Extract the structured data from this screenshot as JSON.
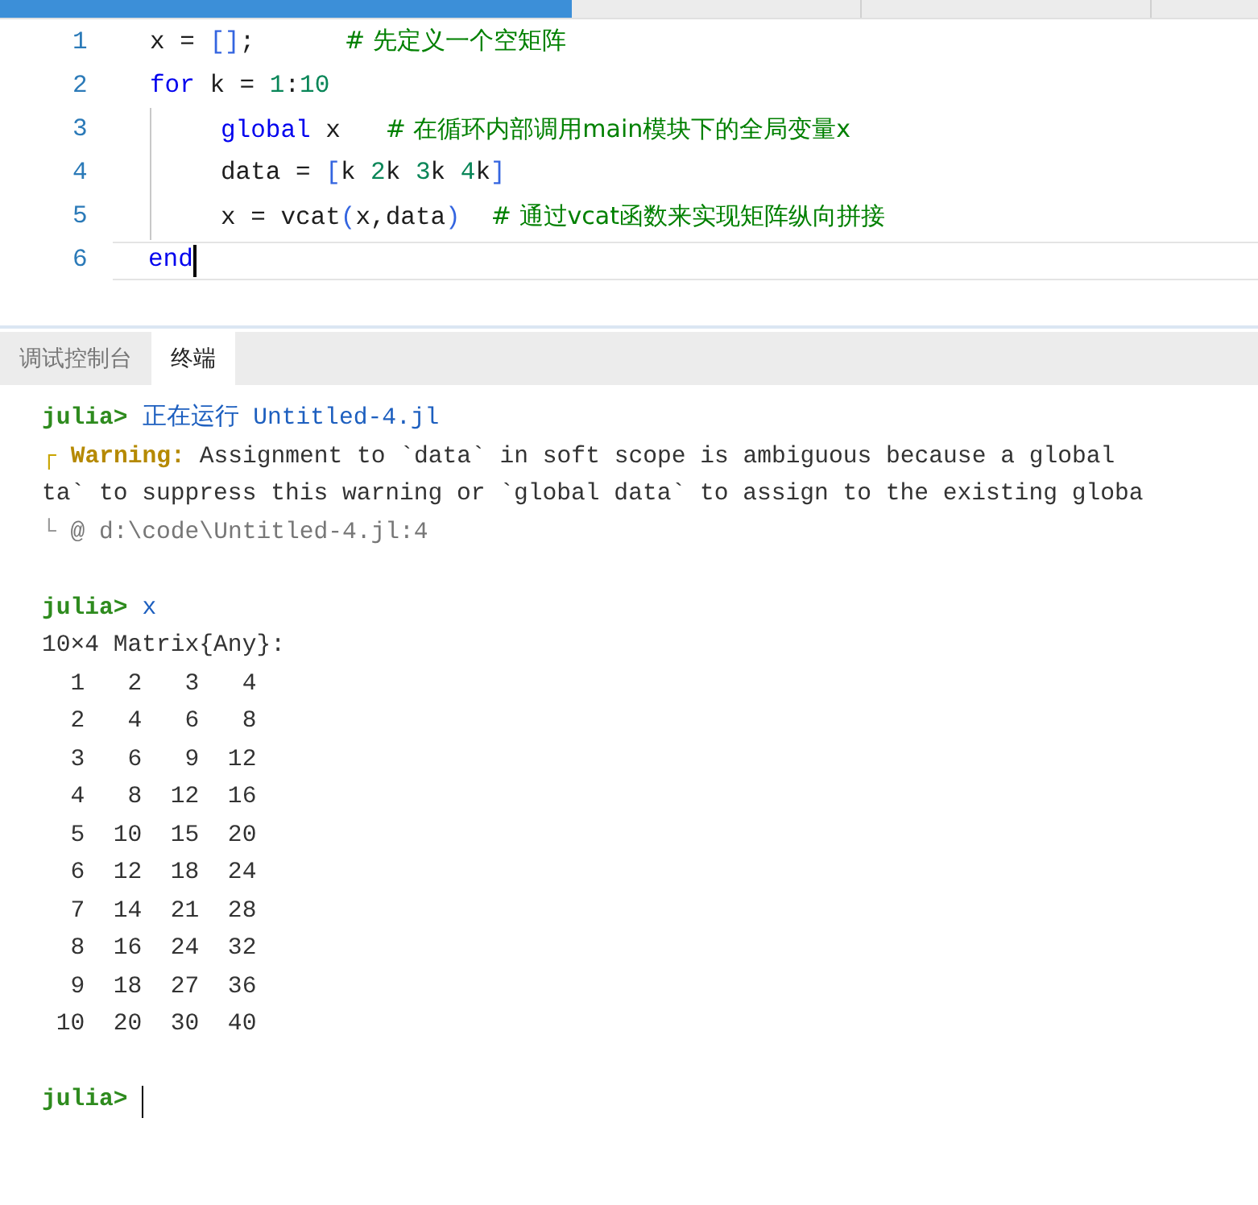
{
  "editor": {
    "tabs": [
      {
        "selected": true
      },
      {
        "selected": false
      },
      {
        "selected": false
      }
    ],
    "lines": [
      {
        "number": "1",
        "current": false,
        "indent": false,
        "tokens": [
          {
            "kind": "plain",
            "text": "x = "
          },
          {
            "kind": "bracket",
            "text": "[]"
          },
          {
            "kind": "plain",
            "text": ";      "
          },
          {
            "kind": "comment",
            "text": "# 先定义一个空矩阵"
          }
        ]
      },
      {
        "number": "2",
        "current": false,
        "indent": false,
        "tokens": [
          {
            "kind": "keyword",
            "text": "for"
          },
          {
            "kind": "plain",
            "text": " k = "
          },
          {
            "kind": "number",
            "text": "1"
          },
          {
            "kind": "plain",
            "text": ":"
          },
          {
            "kind": "number",
            "text": "10"
          }
        ]
      },
      {
        "number": "3",
        "current": false,
        "indent": true,
        "tokens": [
          {
            "kind": "keyword",
            "text": "global"
          },
          {
            "kind": "plain",
            "text": " x   "
          },
          {
            "kind": "comment",
            "text": "# 在循环内部调用main模块下的全局变量x"
          }
        ]
      },
      {
        "number": "4",
        "current": false,
        "indent": true,
        "tokens": [
          {
            "kind": "plain",
            "text": "data = "
          },
          {
            "kind": "bracket",
            "text": "["
          },
          {
            "kind": "plain",
            "text": "k "
          },
          {
            "kind": "number",
            "text": "2"
          },
          {
            "kind": "plain",
            "text": "k "
          },
          {
            "kind": "number",
            "text": "3"
          },
          {
            "kind": "plain",
            "text": "k "
          },
          {
            "kind": "number",
            "text": "4"
          },
          {
            "kind": "plain",
            "text": "k"
          },
          {
            "kind": "bracket",
            "text": "]"
          }
        ]
      },
      {
        "number": "5",
        "current": false,
        "indent": true,
        "tokens": [
          {
            "kind": "plain",
            "text": "x = vcat"
          },
          {
            "kind": "bracket",
            "text": "("
          },
          {
            "kind": "plain",
            "text": "x,data"
          },
          {
            "kind": "bracket",
            "text": ")"
          },
          {
            "kind": "comment",
            "text": "    # 通过vcat函数来实现矩阵纵向拼接"
          }
        ]
      },
      {
        "number": "6",
        "current": true,
        "indent": false,
        "tokens": [
          {
            "kind": "keyword",
            "text": "end"
          }
        ]
      }
    ]
  },
  "panel": {
    "tabs": [
      {
        "label": "调试控制台",
        "selected": false
      },
      {
        "label": "终端",
        "selected": true
      }
    ],
    "terminal": [
      {
        "kind": "prompt",
        "prompt": "julia>",
        "text": "正在运行 Untitled-4.jl"
      },
      {
        "kind": "warning_head",
        "mark": "┌",
        "label": "Warning:",
        "text": " Assignment to `data` in soft scope is ambiguous because a global"
      },
      {
        "kind": "output",
        "text": "ta` to suppress this warning or `global data` to assign to the existing globa"
      },
      {
        "kind": "warning_tail",
        "mark": "└",
        "text": " @ d:\\code\\Untitled-4.jl:4"
      },
      {
        "kind": "blank"
      },
      {
        "kind": "prompt",
        "prompt": "julia>",
        "text": "x"
      },
      {
        "kind": "output",
        "text": "10×4 Matrix{Any}:"
      },
      {
        "kind": "output",
        "text": "  1   2   3   4"
      },
      {
        "kind": "output",
        "text": "  2   4   6   8"
      },
      {
        "kind": "output",
        "text": "  3   6   9  12"
      },
      {
        "kind": "output",
        "text": "  4   8  12  16"
      },
      {
        "kind": "output",
        "text": "  5  10  15  20"
      },
      {
        "kind": "output",
        "text": "  6  12  18  24"
      },
      {
        "kind": "output",
        "text": "  7  14  21  28"
      },
      {
        "kind": "output",
        "text": "  8  16  24  32"
      },
      {
        "kind": "output",
        "text": "  9  18  27  36"
      },
      {
        "kind": "output",
        "text": " 10  20  30  40"
      },
      {
        "kind": "blank"
      },
      {
        "kind": "prompt",
        "prompt": "julia>",
        "cursor": true
      }
    ]
  }
}
